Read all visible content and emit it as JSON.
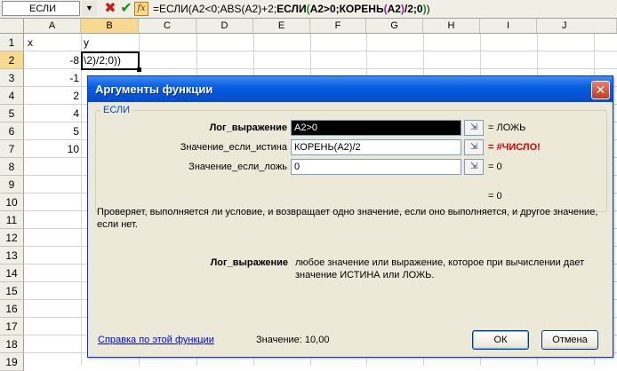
{
  "formula_bar": {
    "name_box": "ЕСЛИ",
    "dropdown_glyph": "▼",
    "cancel_glyph": "✖",
    "enter_glyph": "✔",
    "fx_glyph": "fx",
    "formula_part1": "=ЕСЛИ(A2<0;ABS(A2)+2;",
    "formula_part2": "ЕСЛИ",
    "formula_part3": "(",
    "formula_part4": "A2>0;КОРЕНЬ",
    "formula_part5": "(",
    "formula_part6": "A2",
    "formula_part7": ")",
    "formula_part8": "/2;0",
    "formula_part9": ")",
    "formula_part10": ")"
  },
  "grid": {
    "columns": [
      "A",
      "B",
      "C",
      "D",
      "E",
      "F",
      "G",
      "H",
      "I",
      "J"
    ],
    "rows": [
      "1",
      "2",
      "3",
      "4",
      "5",
      "6",
      "7",
      "8",
      "9",
      "10",
      "11",
      "12",
      "13",
      "14",
      "15",
      "16",
      "17",
      "18",
      "19"
    ],
    "active_column": "B",
    "active_row": "2",
    "header_a1": "x",
    "header_b1": "y",
    "a_values": [
      "-8",
      "-1",
      "2",
      "4",
      "5",
      "10"
    ],
    "edit_text": "\\2)/2;0))"
  },
  "dialog": {
    "title": "Аргументы функции",
    "close_glyph": "✕",
    "group_title": "ЕСЛИ",
    "args": [
      {
        "label": "Лог_выражение",
        "value": "A2>0",
        "result": "= ЛОЖЬ"
      },
      {
        "label": "Значение_если_истина",
        "value": "КОРЕНЬ(A2)/2",
        "result": "= #ЧИСЛО!"
      },
      {
        "label": "Значение_если_ложь",
        "value": "0",
        "result": "= 0"
      }
    ],
    "collapse_glyph": "⇲",
    "total_result": "= 0",
    "description": "Проверяет, выполняется ли условие, и возвращает одно значение, если оно выполняется, и другое значение, если нет.",
    "arg_desc_name": "Лог_выражение",
    "arg_desc_text": "любое значение или выражение, которое при вычислении дает значение ИСТИНА или ЛОЖЬ.",
    "help_link": "Справка по этой функции",
    "value_label": "Значение:",
    "value": "10,00",
    "ok": "ОК",
    "cancel": "Отмена"
  },
  "colors": {
    "title_bar": "#0554d8",
    "error": "#e00000",
    "link": "#0000ee",
    "active_header": "#f7d98f"
  }
}
